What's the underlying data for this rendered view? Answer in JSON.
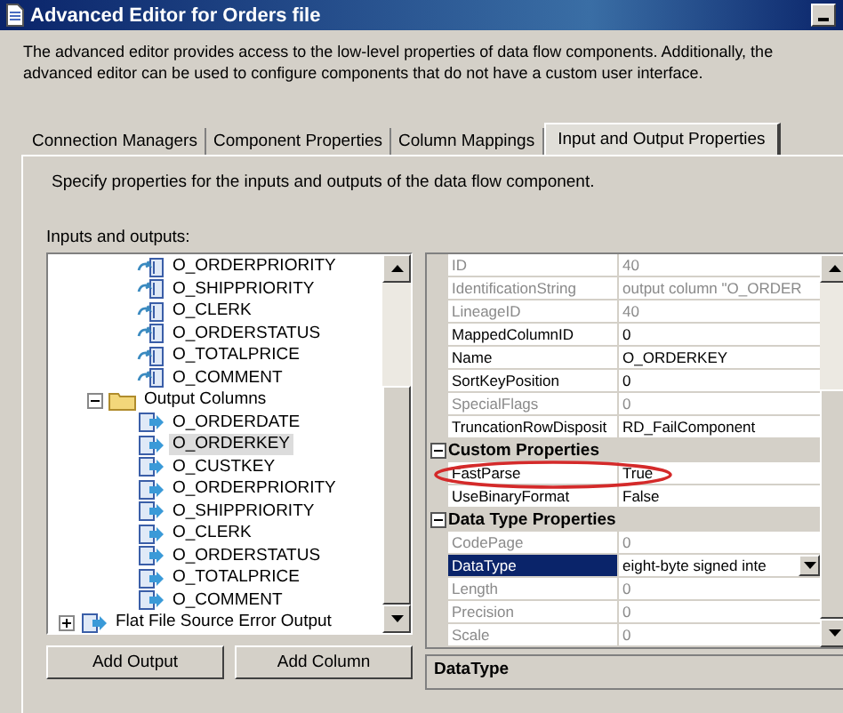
{
  "window": {
    "title": "Advanced Editor for Orders file"
  },
  "description": "The advanced editor provides access to the low-level properties of data flow components. Additionally, the advanced editor can be used to configure components that do not have a custom user interface.",
  "tabs": [
    {
      "label": "Connection Managers",
      "selected": false
    },
    {
      "label": "Component Properties",
      "selected": false
    },
    {
      "label": "Column Mappings",
      "selected": false
    },
    {
      "label": "Input and Output Properties",
      "selected": true
    }
  ],
  "panel_hint": "Specify properties for the inputs and outputs of the data flow component.",
  "tree": {
    "label": "Inputs and outputs:",
    "nodes": [
      {
        "children": [
          {
            "children": [
              {
                "label": "O_ORDERPRIORITY",
                "kind": "external_column",
                "selected": false
              },
              {
                "label": "O_SHIPPRIORITY",
                "kind": "external_column",
                "selected": false
              },
              {
                "label": "O_CLERK",
                "kind": "external_column",
                "selected": false
              },
              {
                "label": "O_ORDERSTATUS",
                "kind": "external_column",
                "selected": false
              },
              {
                "label": "O_TOTALPRICE",
                "kind": "external_column",
                "selected": false
              },
              {
                "label": "O_COMMENT",
                "kind": "external_column",
                "selected": false
              }
            ]
          },
          {
            "label": "Output Columns",
            "kind": "folder",
            "expanded": true,
            "selected": false,
            "children": [
              {
                "label": "O_ORDERDATE",
                "kind": "output_column",
                "selected": false
              },
              {
                "label": "O_ORDERKEY",
                "kind": "output_column",
                "selected": true
              },
              {
                "label": "O_CUSTKEY",
                "kind": "output_column",
                "selected": false
              },
              {
                "label": "O_ORDERPRIORITY",
                "kind": "output_column",
                "selected": false
              },
              {
                "label": "O_SHIPPRIORITY",
                "kind": "output_column",
                "selected": false
              },
              {
                "label": "O_CLERK",
                "kind": "output_column",
                "selected": false
              },
              {
                "label": "O_ORDERSTATUS",
                "kind": "output_column",
                "selected": false
              },
              {
                "label": "O_TOTALPRICE",
                "kind": "output_column",
                "selected": false
              },
              {
                "label": "O_COMMENT",
                "kind": "output_column",
                "selected": false
              }
            ]
          }
        ]
      },
      {
        "label": "Flat File Source Error Output",
        "kind": "output",
        "expanded": false,
        "selected": false
      }
    ]
  },
  "properties": {
    "groups": [
      {
        "rows": [
          {
            "name": "ID",
            "value": "40",
            "disabled": true,
            "selected": false,
            "kind": "text"
          },
          {
            "name": "IdentificationString",
            "value": "output column \"O_ORDER",
            "disabled": true,
            "selected": false,
            "kind": "text"
          },
          {
            "name": "LineageID",
            "value": "40",
            "disabled": true,
            "selected": false,
            "kind": "text"
          },
          {
            "name": "MappedColumnID",
            "value": "0",
            "disabled": false,
            "selected": false,
            "kind": "text"
          },
          {
            "name": "Name",
            "value": "O_ORDERKEY",
            "disabled": false,
            "selected": false,
            "kind": "text"
          },
          {
            "name": "SortKeyPosition",
            "value": "0",
            "disabled": false,
            "selected": false,
            "kind": "text"
          },
          {
            "name": "SpecialFlags",
            "value": "0",
            "disabled": true,
            "selected": false,
            "kind": "text"
          },
          {
            "name": "TruncationRowDisposit",
            "value": "RD_FailComponent",
            "disabled": false,
            "selected": false,
            "kind": "text"
          }
        ]
      },
      {
        "title": "Custom Properties",
        "expanded": true,
        "rows": [
          {
            "name": "FastParse",
            "value": "True",
            "disabled": false,
            "selected": false,
            "kind": "text"
          },
          {
            "name": "UseBinaryFormat",
            "value": "False",
            "disabled": false,
            "selected": false,
            "kind": "text"
          }
        ]
      },
      {
        "title": "Data Type Properties",
        "expanded": true,
        "rows": [
          {
            "name": "CodePage",
            "value": "0",
            "disabled": true,
            "selected": false,
            "kind": "text"
          },
          {
            "name": "DataType",
            "value": "eight-byte signed inte",
            "disabled": false,
            "selected": true,
            "kind": "dropdown"
          },
          {
            "name": "Length",
            "value": "0",
            "disabled": true,
            "selected": false,
            "kind": "text"
          },
          {
            "name": "Precision",
            "value": "0",
            "disabled": true,
            "selected": false,
            "kind": "text"
          },
          {
            "name": "Scale",
            "value": "0",
            "disabled": true,
            "selected": false,
            "kind": "text"
          }
        ]
      }
    ],
    "help_title": "DataType"
  },
  "buttons": [
    "Add Output",
    "Add Column"
  ]
}
